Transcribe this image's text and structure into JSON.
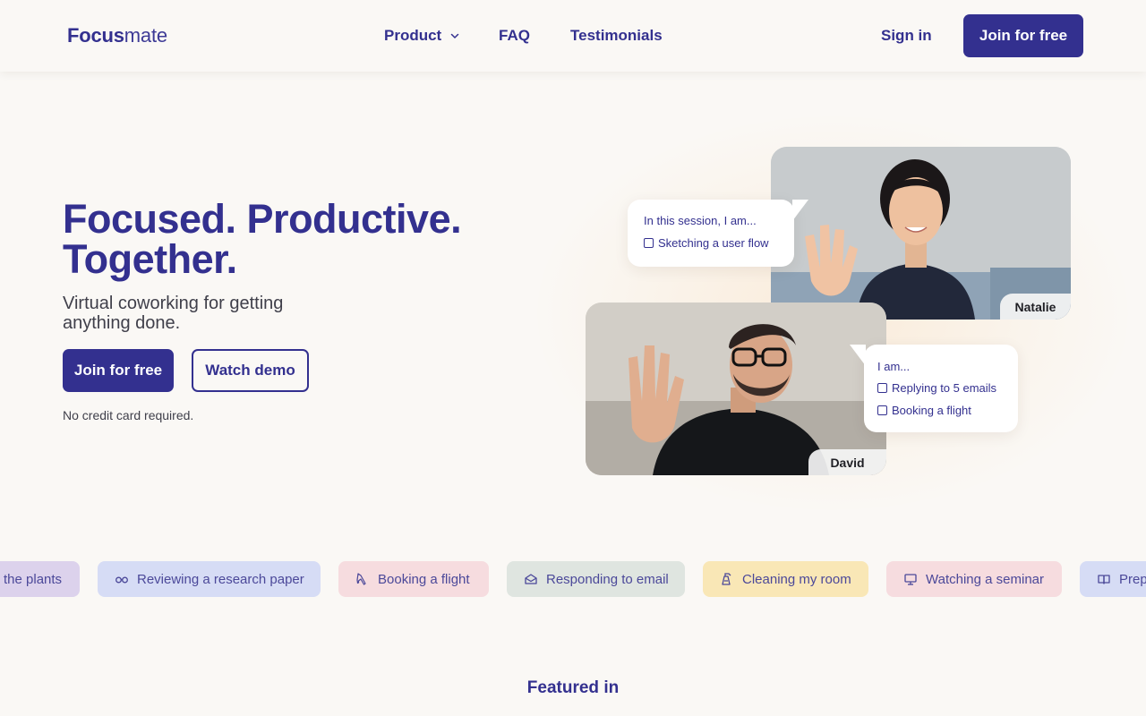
{
  "header": {
    "logo_bold": "Focus",
    "logo_light": "mate",
    "nav": {
      "product": "Product",
      "faq": "FAQ",
      "testimonials": "Testimonials"
    },
    "sign_in": "Sign in",
    "join_label": "Join for free"
  },
  "hero": {
    "title_line1": "Focused. Productive.",
    "title_line2": "Together.",
    "subtitle": "Virtual coworking for getting anything done.",
    "join_label": "Join for free",
    "demo_label": "Watch demo",
    "note": "No credit card required."
  },
  "session": {
    "natalie": {
      "name": "Natalie",
      "intro": "In this session, I am...",
      "tasks": [
        "Sketching a user flow"
      ]
    },
    "david": {
      "name": "David",
      "intro": "I am...",
      "tasks": [
        "Replying to 5 emails",
        "Booking a flight"
      ]
    }
  },
  "chips": [
    {
      "label": "the plants",
      "icon": "plant-icon",
      "color": "#dcd2ec"
    },
    {
      "label": "Reviewing a research paper",
      "icon": "glasses-icon",
      "color": "#d6dcf5"
    },
    {
      "label": "Booking a flight",
      "icon": "airplane-icon",
      "color": "#f6dcdf"
    },
    {
      "label": "Responding to email",
      "icon": "envelope-open-icon",
      "color": "#dfe5e0"
    },
    {
      "label": "Cleaning my room",
      "icon": "spray-bottle-icon",
      "color": "#f9e7b6"
    },
    {
      "label": "Watching a seminar",
      "icon": "monitor-icon",
      "color": "#f6dcdf"
    },
    {
      "label": "Prep",
      "icon": "book-open-icon",
      "color": "#d6dcf5"
    }
  ],
  "featured": "Featured in",
  "colors": {
    "brand": "#33308f",
    "background": "#faf8f5"
  }
}
